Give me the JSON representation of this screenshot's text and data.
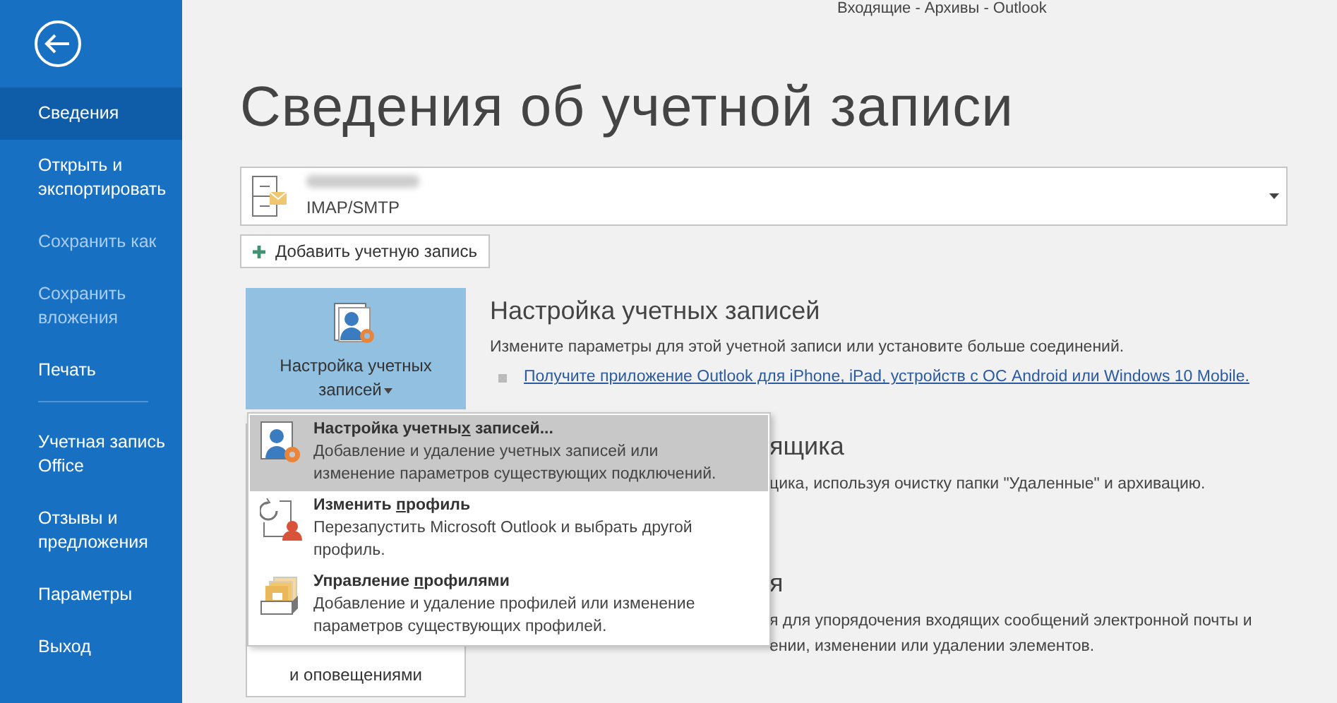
{
  "window": {
    "title": "Входящие - Архивы - Outlook"
  },
  "sidebar": {
    "items": [
      {
        "label": "Сведения",
        "selected": true,
        "disabled": false
      },
      {
        "label": "Открыть и экспортировать",
        "selected": false,
        "disabled": false
      },
      {
        "label": "Сохранить как",
        "selected": false,
        "disabled": true
      },
      {
        "label": "Сохранить вложения",
        "selected": false,
        "disabled": true
      },
      {
        "label": "Печать",
        "selected": false,
        "disabled": false,
        "divider_after": true
      },
      {
        "label": "Учетная запись Office",
        "selected": false,
        "disabled": false
      },
      {
        "label": "Отзывы и предложения",
        "selected": false,
        "disabled": false
      },
      {
        "label": "Параметры",
        "selected": false,
        "disabled": false
      },
      {
        "label": "Выход",
        "selected": false,
        "disabled": false
      }
    ]
  },
  "heading": "Сведения об учетной записи",
  "account": {
    "type": "IMAP/SMTP"
  },
  "add_account": "Добавить учетную запись",
  "account_settings": {
    "button": "Настройка учетных записей",
    "title": "Настройка учетных записей",
    "description": "Измените параметры для этой учетной записи или установите больше соединений.",
    "link": "Получите приложение Outlook для iPhone, iPad, устройств с ОС Android или Windows 10 Mobile."
  },
  "hidden_sections": [
    {
      "title": "ящика",
      "lines": [
        "цика, используя очистку папки \"Удаленные\" и архивацию."
      ]
    },
    {
      "title": "я",
      "lines": [
        "я для упорядочения входящих сообщений электронной почты и",
        "ении, изменении или удалении элементов."
      ]
    }
  ],
  "rules_button": "и оповещениями",
  "menu": {
    "items": [
      {
        "kind": "settings",
        "title_parts": [
          "Настройка учетны",
          "х",
          " записей..."
        ],
        "description": "Добавление и удаление учетных записей или изменение параметров существующих подключений.",
        "selected": true
      },
      {
        "kind": "profile",
        "title_parts": [
          "Изменить ",
          "п",
          "рофиль"
        ],
        "description": "Перезапустить Microsoft Outlook и выбрать другой профиль.",
        "selected": false
      },
      {
        "kind": "manage",
        "title_parts": [
          "Управление ",
          "п",
          "рофилями"
        ],
        "description": "Добавление и удаление профилей или изменение параметров существующих профилей.",
        "selected": false
      }
    ]
  }
}
